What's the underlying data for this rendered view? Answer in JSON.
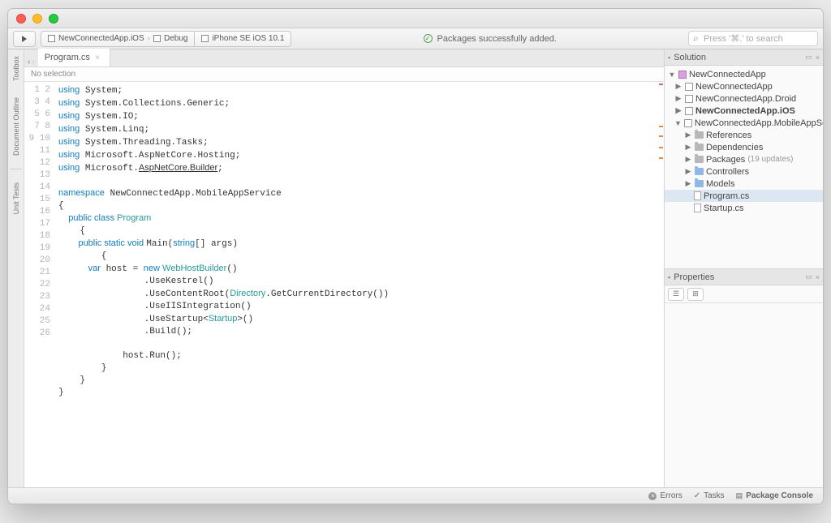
{
  "toolbar": {
    "project": "NewConnectedApp.iOS",
    "config": "Debug",
    "device": "iPhone SE iOS 10.1",
    "status": "Packages successfully added.",
    "search_placeholder": "Press '⌘.' to search"
  },
  "left_pads": [
    "Toolbox",
    "Document Outline",
    "Unit Tests"
  ],
  "tab": {
    "filename": "Program.cs"
  },
  "breadcrumb": "No selection",
  "code": {
    "lines": 26,
    "l1a": "using",
    "l1b": " System;",
    "l2a": "using",
    "l2b": " System.Collections.Generic;",
    "l3a": "using",
    "l3b": " System.IO;",
    "l4a": "using",
    "l4b": " System.Linq;",
    "l5a": "using",
    "l5b": " System.Threading.Tasks;",
    "l6a": "using",
    "l6b": " Microsoft.AspNetCore.Hosting;",
    "l7a": "using",
    "l7b": " Microsoft.",
    "l7c": "AspNetCore.Builder",
    "l7d": ";",
    "l9a": "namespace",
    "l9b": " NewConnectedApp.MobileAppService",
    "l10": "{",
    "l11a": "    public class ",
    "l11b": "Program",
    "l12": "    {",
    "l13a": "        public static void ",
    "l13b": "Main",
    "l13c": "(",
    "l13d": "string",
    "l13e": "[] args)",
    "l14": "        {",
    "l15a": "            var",
    "l15b": " host = ",
    "l15c": "new ",
    "l15d": "WebHostBuilder",
    "l15e": "()",
    "l16": "                .UseKestrel()",
    "l17a": "                .UseContentRoot(",
    "l17b": "Directory",
    "l17c": ".GetCurrentDirectory())",
    "l18": "                .UseIISIntegration()",
    "l19a": "                .UseStartup<",
    "l19b": "Startup",
    "l19c": ">()",
    "l20": "                .Build();",
    "l22": "            host.Run();",
    "l23": "        }",
    "l24": "    }",
    "l25": "}"
  },
  "solution": {
    "title": "Solution",
    "root": "NewConnectedApp",
    "projects": [
      {
        "name": "NewConnectedApp",
        "bold": false
      },
      {
        "name": "NewConnectedApp.Droid",
        "bold": false
      },
      {
        "name": "NewConnectedApp.iOS",
        "bold": true
      },
      {
        "name": "NewConnectedApp.MobileAppService",
        "bold": false,
        "expanded": true
      }
    ],
    "folders": [
      {
        "name": "References",
        "cls": "gr"
      },
      {
        "name": "Dependencies",
        "cls": "gr"
      },
      {
        "name": "Packages",
        "note": "(19 updates)",
        "cls": "gr"
      },
      {
        "name": "Controllers",
        "cls": ""
      },
      {
        "name": "Models",
        "cls": ""
      }
    ],
    "files": [
      {
        "name": "Program.cs",
        "sel": true
      },
      {
        "name": "Startup.cs",
        "sel": false
      }
    ]
  },
  "properties": {
    "title": "Properties"
  },
  "status": {
    "errors": "Errors",
    "tasks": "Tasks",
    "console": "Package Console"
  }
}
